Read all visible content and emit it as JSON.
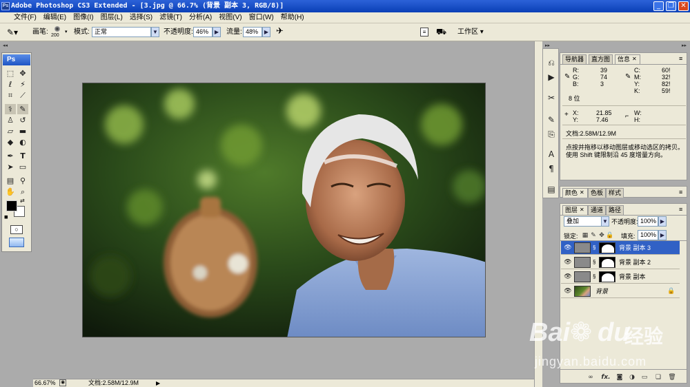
{
  "window": {
    "app_icon": "Ps",
    "title": "Adobe Photoshop CS3 Extended - [3.jpg @ 66.7% (背景 副本 3, RGB/8)]",
    "buttons": {
      "minimize": "_",
      "restore": "❐",
      "close": "✕"
    }
  },
  "menu": [
    "文件(F)",
    "编辑(E)",
    "图像(I)",
    "图层(L)",
    "选择(S)",
    "滤镜(T)",
    "分析(A)",
    "视图(V)",
    "窗口(W)",
    "帮助(H)"
  ],
  "options": {
    "brush_label": "画笔:",
    "brush_size": "200",
    "mode_label": "模式:",
    "mode_value": "正常",
    "opacity_label": "不透明度:",
    "opacity_value": "46%",
    "flow_label": "流量:",
    "flow_value": "48%",
    "workspace_label": "工作区"
  },
  "toolbox": {
    "logo": "Ps",
    "icons": [
      "marquee-icon",
      "move-icon",
      "lasso-icon",
      "magic-wand-icon",
      "crop-icon",
      "slice-icon",
      "healing-brush-icon",
      "brush-icon",
      "clone-stamp-icon",
      "history-brush-icon",
      "eraser-icon",
      "gradient-icon",
      "blur-icon",
      "dodge-icon",
      "pen-icon",
      "type-icon",
      "path-select-icon",
      "shape-icon",
      "notes-icon",
      "eyedropper-icon",
      "hand-icon",
      "zoom-icon"
    ],
    "foreground_color": "#000000",
    "background_color": "#ffffff"
  },
  "status": {
    "zoom": "66.67%",
    "doc": "文档:2.58M/12.9M"
  },
  "info_panel": {
    "tabs": [
      "导航器",
      "直方图",
      "信息"
    ],
    "active_tab": "信息",
    "rgb": [
      {
        "label": "R:",
        "value": "39"
      },
      {
        "label": "G:",
        "value": "74"
      },
      {
        "label": "B:",
        "value": "3"
      }
    ],
    "bits1": "8 位",
    "cmyk": [
      {
        "label": "C:",
        "value": "60!"
      },
      {
        "label": "M:",
        "value": "32!"
      },
      {
        "label": "Y:",
        "value": "82!"
      },
      {
        "label": "K:",
        "value": "59!"
      }
    ],
    "x": "21.85",
    "y": "7.46",
    "w_label": "W:",
    "h_label": "H:",
    "x_label": "X:",
    "y_label": "Y:",
    "doc": "文档:2.58M/12.9M",
    "hint1": "点按并拖移以移动图层或移动选区的拷贝。",
    "hint2": "使用 Shift 键限制沿 45 度增量方向。"
  },
  "color_panel": {
    "tabs": [
      "颜色",
      "色板",
      "样式"
    ],
    "active_tab": "颜色"
  },
  "layers_panel": {
    "tabs": [
      "图层",
      "通道",
      "路径"
    ],
    "active_tab": "图层",
    "blend_mode": "叠加",
    "opacity_label": "不透明度:",
    "opacity_value": "100%",
    "lock_label": "锁定:",
    "fill_label": "填充:",
    "fill_value": "100%",
    "layers": [
      {
        "name": "背景 副本 3",
        "selected": true
      },
      {
        "name": "背景 副本 2",
        "selected": false
      },
      {
        "name": "背景 副本",
        "selected": false
      },
      {
        "name": "背景",
        "selected": false
      }
    ],
    "bottom_icons": [
      "link-icon",
      "fx-icon",
      "mask-icon",
      "adjustment-icon",
      "folder-icon",
      "new-layer-icon",
      "trash-icon"
    ],
    "fx_label": "fx."
  },
  "watermark": {
    "brand": "Bai",
    "brand2": "du",
    "cn": "经验",
    "url": "jingyan.baidu.com"
  }
}
